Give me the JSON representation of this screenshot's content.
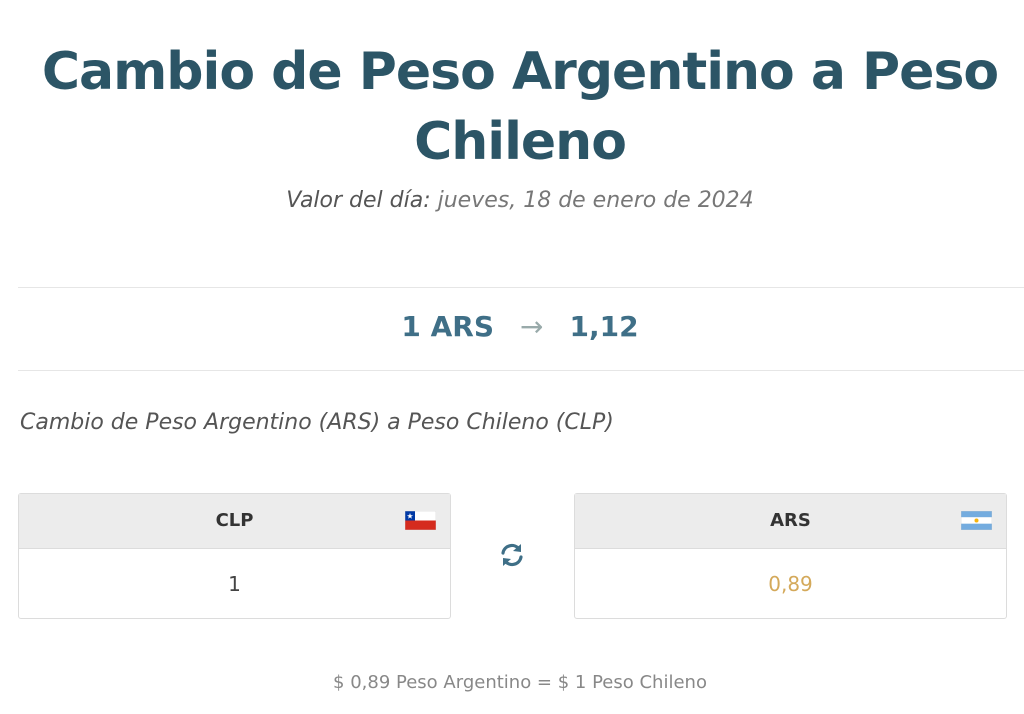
{
  "header": {
    "title_line1": "Cambio de Peso Argentino a Peso",
    "title_line2": "Chileno"
  },
  "date": {
    "label": "Valor del día:",
    "value": "jueves, 18 de enero de 2024"
  },
  "rate": {
    "from": "1 ARS",
    "arrow": "→",
    "to": "1,12"
  },
  "subtitle": "Cambio de Peso Argentino (ARS) a Peso Chileno (CLP)",
  "converter": {
    "left": {
      "code": "CLP",
      "value": "1",
      "flag_icon": "chile-flag-icon"
    },
    "right": {
      "code": "ARS",
      "value": "0,89",
      "flag_icon": "argentina-flag-icon"
    },
    "swap_icon": "swap-icon",
    "accent_color": "#d4a95a"
  },
  "footer": "$ 0,89 Peso Argentino = $ 1 Peso Chileno",
  "colors": {
    "title": "#2c5566",
    "rate": "#3f6f87"
  }
}
